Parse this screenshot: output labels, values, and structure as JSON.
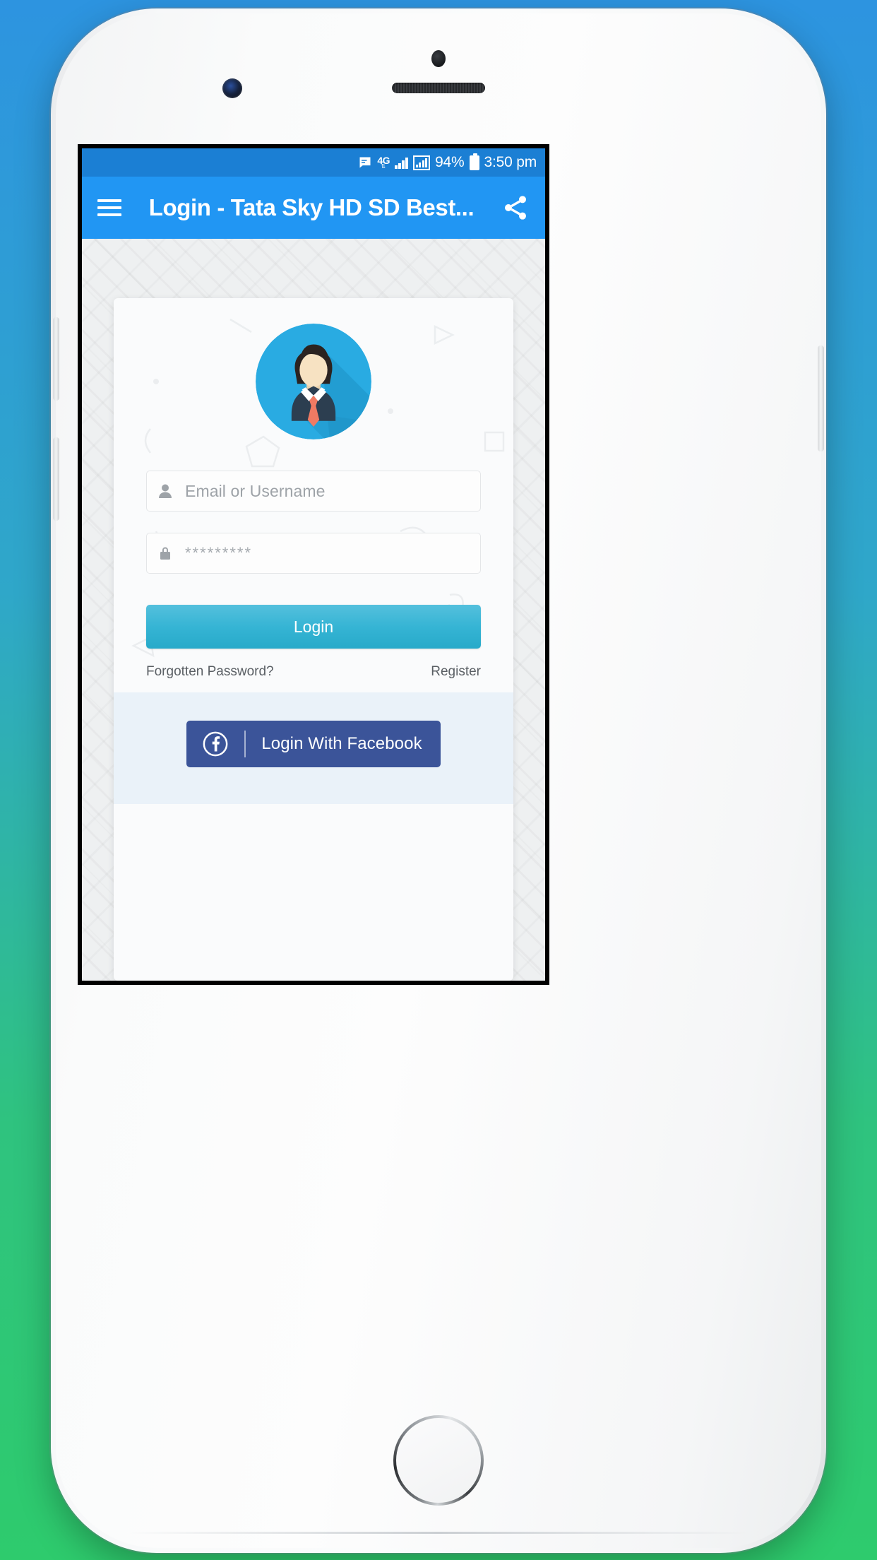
{
  "device": {
    "name": "white-smartphone",
    "sensors": [
      "proximity-sensor",
      "earpiece-speaker",
      "front-camera"
    ],
    "home_button": "home-button"
  },
  "statusbar": {
    "sms_icon": "sms-icon",
    "network_label": "4G",
    "network_arrows": "⇅",
    "signal_icon": "signal-bars-icon",
    "signal_boxed_icon": "signal-bars-boxed-icon",
    "battery_percent": "94%",
    "battery_icon": "battery-icon",
    "time": "3:50 pm",
    "bg_color": "#1b7fd4"
  },
  "appbar": {
    "menu_icon": "hamburger-menu-icon",
    "title": "Login - Tata Sky HD SD Best...",
    "share_icon": "share-icon",
    "bg_color": "#2196f3"
  },
  "login_card": {
    "avatar_icon": "user-avatar-icon",
    "avatar_colors": {
      "circle": "#29ABE2",
      "shadow": "#1E8FC0",
      "hair": "#2B2320",
      "skin": "#F7E2C2",
      "suit": "#2C3E50",
      "shirt": "#FFFFFF",
      "tie": "#F07A63"
    },
    "username_field": {
      "icon": "person-icon",
      "placeholder": "Email or Username",
      "value": ""
    },
    "password_field": {
      "icon": "lock-icon",
      "placeholder": "*********",
      "value": ""
    },
    "login_button": {
      "label": "Login",
      "color": "#35b4d4"
    },
    "forgot_link": "Forgotten Password?",
    "register_link": "Register",
    "facebook_button": {
      "icon": "facebook-icon",
      "label": "Login With Facebook",
      "color": "#3b5499"
    }
  }
}
